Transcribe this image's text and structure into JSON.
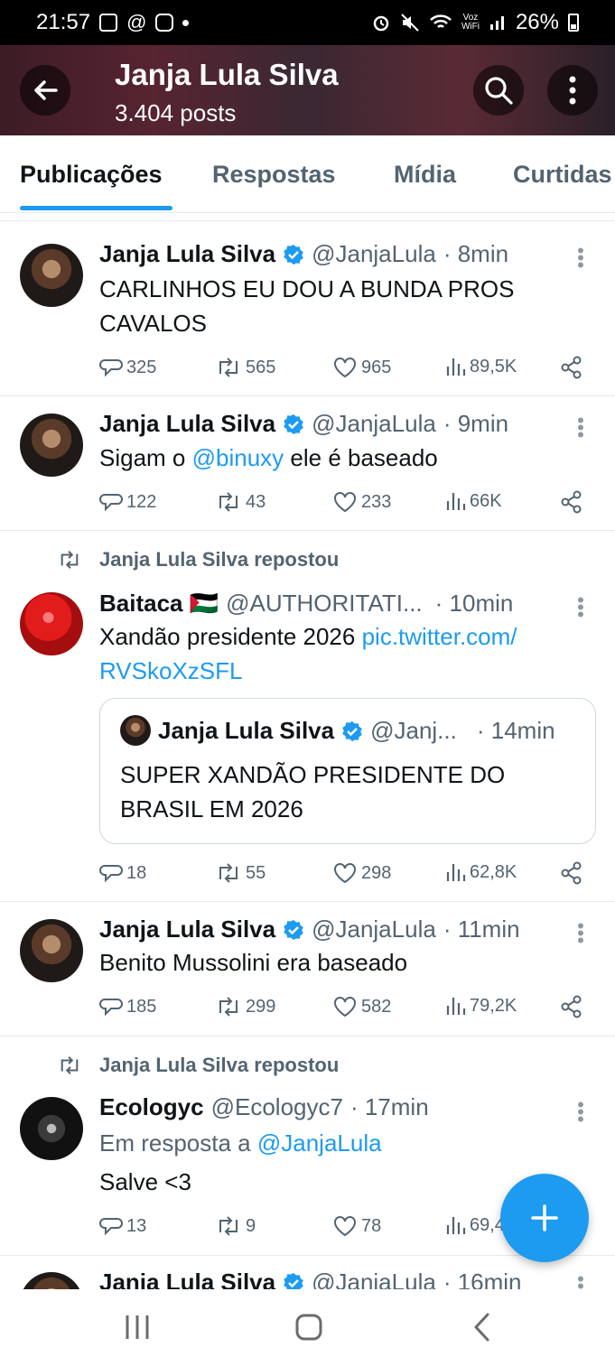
{
  "status_bar": {
    "time": "21:57",
    "network": "Voz\nWiFi",
    "battery": "26%"
  },
  "header": {
    "title": "Janja Lula Silva",
    "subtitle": "3.404 posts"
  },
  "tabs": [
    {
      "label": "Publicações",
      "active": true
    },
    {
      "label": "Respostas",
      "active": false
    },
    {
      "label": "Mídia",
      "active": false
    },
    {
      "label": "Curtidas",
      "active": false
    }
  ],
  "posts": [
    {
      "name": "Janja Lula Silva",
      "handle": "@JanjaLula",
      "time": "· 8min",
      "text_line1": "CARLINHOS EU DOU A BUNDA PROS",
      "text_line2": "CAVALOS",
      "replies": "325",
      "reposts": "565",
      "likes": "965",
      "views": "89,5K"
    },
    {
      "name": "Janja Lula Silva",
      "handle": "@JanjaLula",
      "time": "· 9min",
      "text_pre": "Sigam o ",
      "text_link": "@binuxy",
      "text_post": " ele é baseado",
      "replies": "122",
      "reposts": "43",
      "likes": "233",
      "views": "66K"
    },
    {
      "repost_label": "Janja Lula Silva repostou",
      "name": "Baitaca 🇵🇸",
      "handle": "@AUTHORITATI...",
      "time": "· 10min",
      "text_pre": "Xandão presidente 2026 ",
      "text_link1": "pic.twitter.com/",
      "text_link2": "RVSkoXzSFL",
      "quote": {
        "name": "Janja Lula Silva",
        "handle": "@Janj...",
        "time": "· 14min",
        "text_line1": "SUPER XANDÃO PRESIDENTE DO",
        "text_line2": "BRASIL EM 2026"
      },
      "replies": "18",
      "reposts": "55",
      "likes": "298",
      "views": "62,8K"
    },
    {
      "name": "Janja Lula Silva",
      "handle": "@JanjaLula",
      "time": "· 11min",
      "text": "Benito Mussolini era baseado",
      "replies": "185",
      "reposts": "299",
      "likes": "582",
      "views": "79,2K"
    },
    {
      "repost_label": "Janja Lula Silva repostou",
      "name": "Ecologyc",
      "handle": "@Ecologyc7",
      "time": "· 17min",
      "reply_pre": "Em resposta a ",
      "reply_link": "@JanjaLula",
      "text": "Salve <3",
      "replies": "13",
      "reposts": "9",
      "likes": "78",
      "views": "69,4"
    },
    {
      "name": "Janja Lula Silva",
      "handle": "@JanjaLula",
      "time": "· 16min"
    }
  ],
  "colors": {
    "accent": "#1d9bf0",
    "text": "#0f1419",
    "secondary": "#536471",
    "divider": "#e7e9ea"
  }
}
